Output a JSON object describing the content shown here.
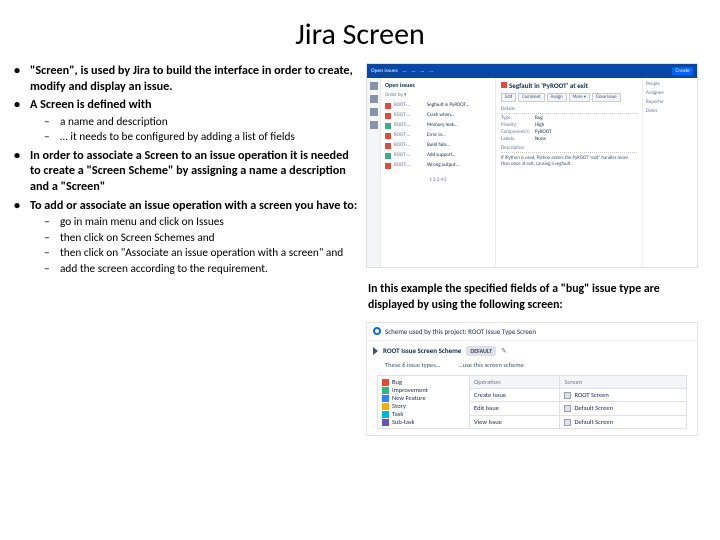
{
  "title": "Jira Screen",
  "bullets": {
    "b1": "\"Screen\", is used by Jira to build the interface in order to create, modify and display an issue.",
    "b2": "A Screen is defined with",
    "b2a": "a name and description",
    "b2b": "… it needs to be configured by adding a list of fields",
    "b3": "In order to associate a Screen to an issue operation it is needed to create a \"Screen Scheme\" by assigning a name a description and a \"Screen\"",
    "b4": "To add or associate an issue operation with a screen you have to:",
    "b4a": "go in main menu and click on Issues",
    "b4b": "then click on Screen Schemes and",
    "b4c": "then click on \"Associate an issue operation with a screen\" and",
    "b4d": "add the screen according to the requirement."
  },
  "caption": "In this example the specified fields of a \"bug\" issue type are displayed by using the following screen:",
  "jira": {
    "top": {
      "t1": "Open issues",
      "t2": "…",
      "t3": "…",
      "t4": "…",
      "t5": "…",
      "t6": "Create"
    },
    "list_title": "Open issues",
    "filters": "Order by ▾",
    "issue_title": "Segfault in 'PyROOT' at exit",
    "btn": {
      "edit": "Edit",
      "comment": "Comment",
      "assign": "Assign",
      "more": "More ▾",
      "close": "Close Issue",
      "reopen": "…"
    },
    "sec_details": "Details",
    "sec_desc": "Description",
    "type_k": "Type:",
    "type_v": "Bug",
    "pri_k": "Priority:",
    "pri_v": "High",
    "comp_k": "Component/s:",
    "comp_v": "PyROOT",
    "lab_k": "Labels:",
    "lab_v": "None",
    "desc": "If IPython is used, Python enters the PyROOT \"exit\" handler more than once at exit, causing a segfault.",
    "side": {
      "people": "People",
      "assignee": "Assignee",
      "reporter": "Reporter",
      "dates": "Dates"
    }
  },
  "scheme": {
    "header": "Scheme used by this project: ROOT Issue Type Screen",
    "title": "ROOT Issue Screen Scheme",
    "default": "DEFAULT",
    "note1": "These 6 issue types…",
    "note2": "…use this screen scheme",
    "col1": "Operation",
    "col2": "Screen",
    "types": {
      "bug": "Bug",
      "imp": "Improvement",
      "nf": "New Feature",
      "story": "Story",
      "task": "Task",
      "sub": "Sub-task"
    },
    "ops": {
      "create": "Create Issue",
      "edit": "Edit Issue",
      "view": "View Issue"
    },
    "screens": {
      "root": "ROOT Screen",
      "default": "Default Screen"
    }
  }
}
